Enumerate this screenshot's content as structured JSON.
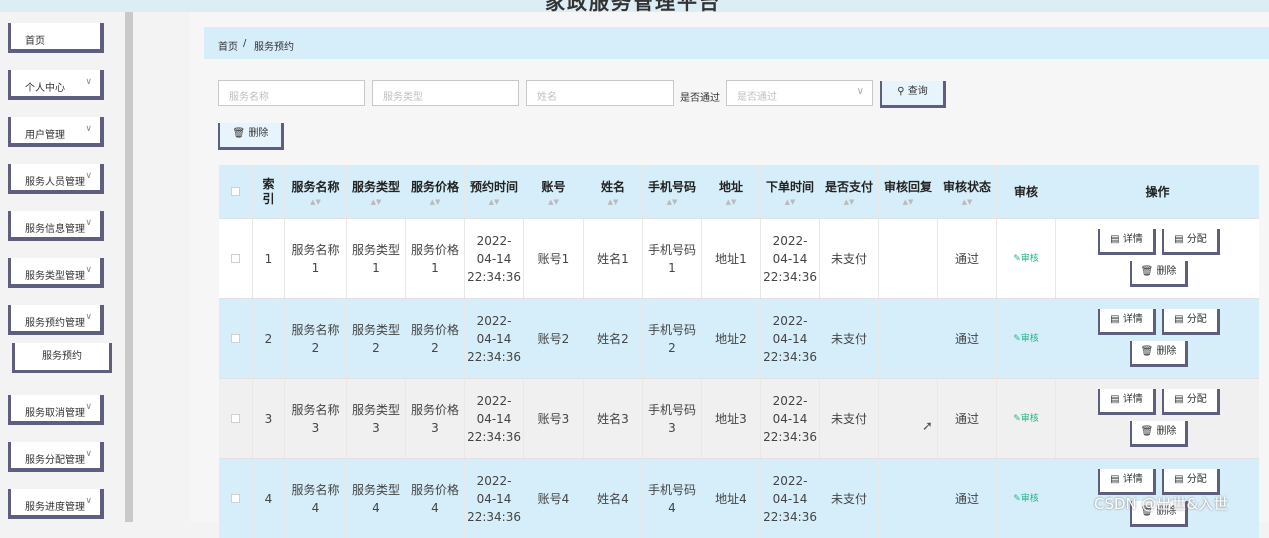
{
  "header": {
    "title": "家政服务管理平台"
  },
  "sidebar": {
    "items": [
      {
        "label": "首页",
        "chevron": false
      },
      {
        "label": "个人中心",
        "chevron": true
      },
      {
        "label": "用户管理",
        "chevron": true
      },
      {
        "label": "服务人员管理",
        "chevron": true
      },
      {
        "label": "服务信息管理",
        "chevron": true
      },
      {
        "label": "服务类型管理",
        "chevron": true
      },
      {
        "label": "服务预约管理",
        "chevron": true
      },
      {
        "label": "服务取消管理",
        "chevron": true
      },
      {
        "label": "服务分配管理",
        "chevron": true
      },
      {
        "label": "服务进度管理",
        "chevron": true
      }
    ],
    "sub_item": "服务预约"
  },
  "breadcrumb": {
    "home": "首页",
    "sep": "/",
    "current": "服务预约"
  },
  "search": {
    "service_name_placeholder": "服务名称",
    "service_type_placeholder": "服务类型",
    "name_placeholder": "姓名",
    "approved_label": "是否通过",
    "approved_placeholder": "是否通过",
    "query_label": "查询",
    "delete_label": "删除"
  },
  "table": {
    "headers": [
      "",
      "索引",
      "服务名称",
      "服务类型",
      "服务价格",
      "预约时间",
      "账号",
      "姓名",
      "手机号码",
      "地址",
      "下单时间",
      "是否支付",
      "审核回复",
      "审核状态",
      "审核",
      "操作"
    ],
    "rows": [
      {
        "index": "1",
        "service_name": "服务名称1",
        "service_type": "服务类型1",
        "service_price": "服务价格1",
        "appointment_time": "2022-04-14 22:34:36",
        "account": "账号1",
        "name": "姓名1",
        "phone": "手机号码1",
        "address": "地址1",
        "order_time": "2022-04-14 22:34:36",
        "paid": "未支付",
        "reply": "",
        "status": "通过",
        "review": "审核"
      },
      {
        "index": "2",
        "service_name": "服务名称2",
        "service_type": "服务类型2",
        "service_price": "服务价格2",
        "appointment_time": "2022-04-14 22:34:36",
        "account": "账号2",
        "name": "姓名2",
        "phone": "手机号码2",
        "address": "地址2",
        "order_time": "2022-04-14 22:34:36",
        "paid": "未支付",
        "reply": "",
        "status": "通过",
        "review": "审核"
      },
      {
        "index": "3",
        "service_name": "服务名称3",
        "service_type": "服务类型3",
        "service_price": "服务价格3",
        "appointment_time": "2022-04-14 22:34:36",
        "account": "账号3",
        "name": "姓名3",
        "phone": "手机号码3",
        "address": "地址3",
        "order_time": "2022-04-14 22:34:36",
        "paid": "未支付",
        "reply": "",
        "status": "通过",
        "review": "审核"
      },
      {
        "index": "4",
        "service_name": "服务名称4",
        "service_type": "服务类型4",
        "service_price": "服务价格4",
        "appointment_time": "2022-04-14 22:34:36",
        "account": "账号4",
        "name": "姓名4",
        "phone": "手机号码4",
        "address": "地址4",
        "order_time": "2022-04-14 22:34:36",
        "paid": "未支付",
        "reply": "",
        "status": "通过",
        "review": "审核"
      }
    ],
    "ops": {
      "detail": "详情",
      "assign": "分配",
      "delete": "删除"
    }
  },
  "watermark": "CSDN @出世&入世",
  "colors": {
    "header_bg": "#d6eefa",
    "row_alt": "#d6eefa",
    "row_grey": "#f0f0f0",
    "accent": "#5e5e7e",
    "review": "#2bb38a"
  },
  "icons": {
    "search": "search-icon",
    "delete": "trash-icon",
    "detail": "document-icon",
    "assign": "document-icon",
    "review": "edit-icon",
    "chevron": "chevron-down-icon"
  }
}
